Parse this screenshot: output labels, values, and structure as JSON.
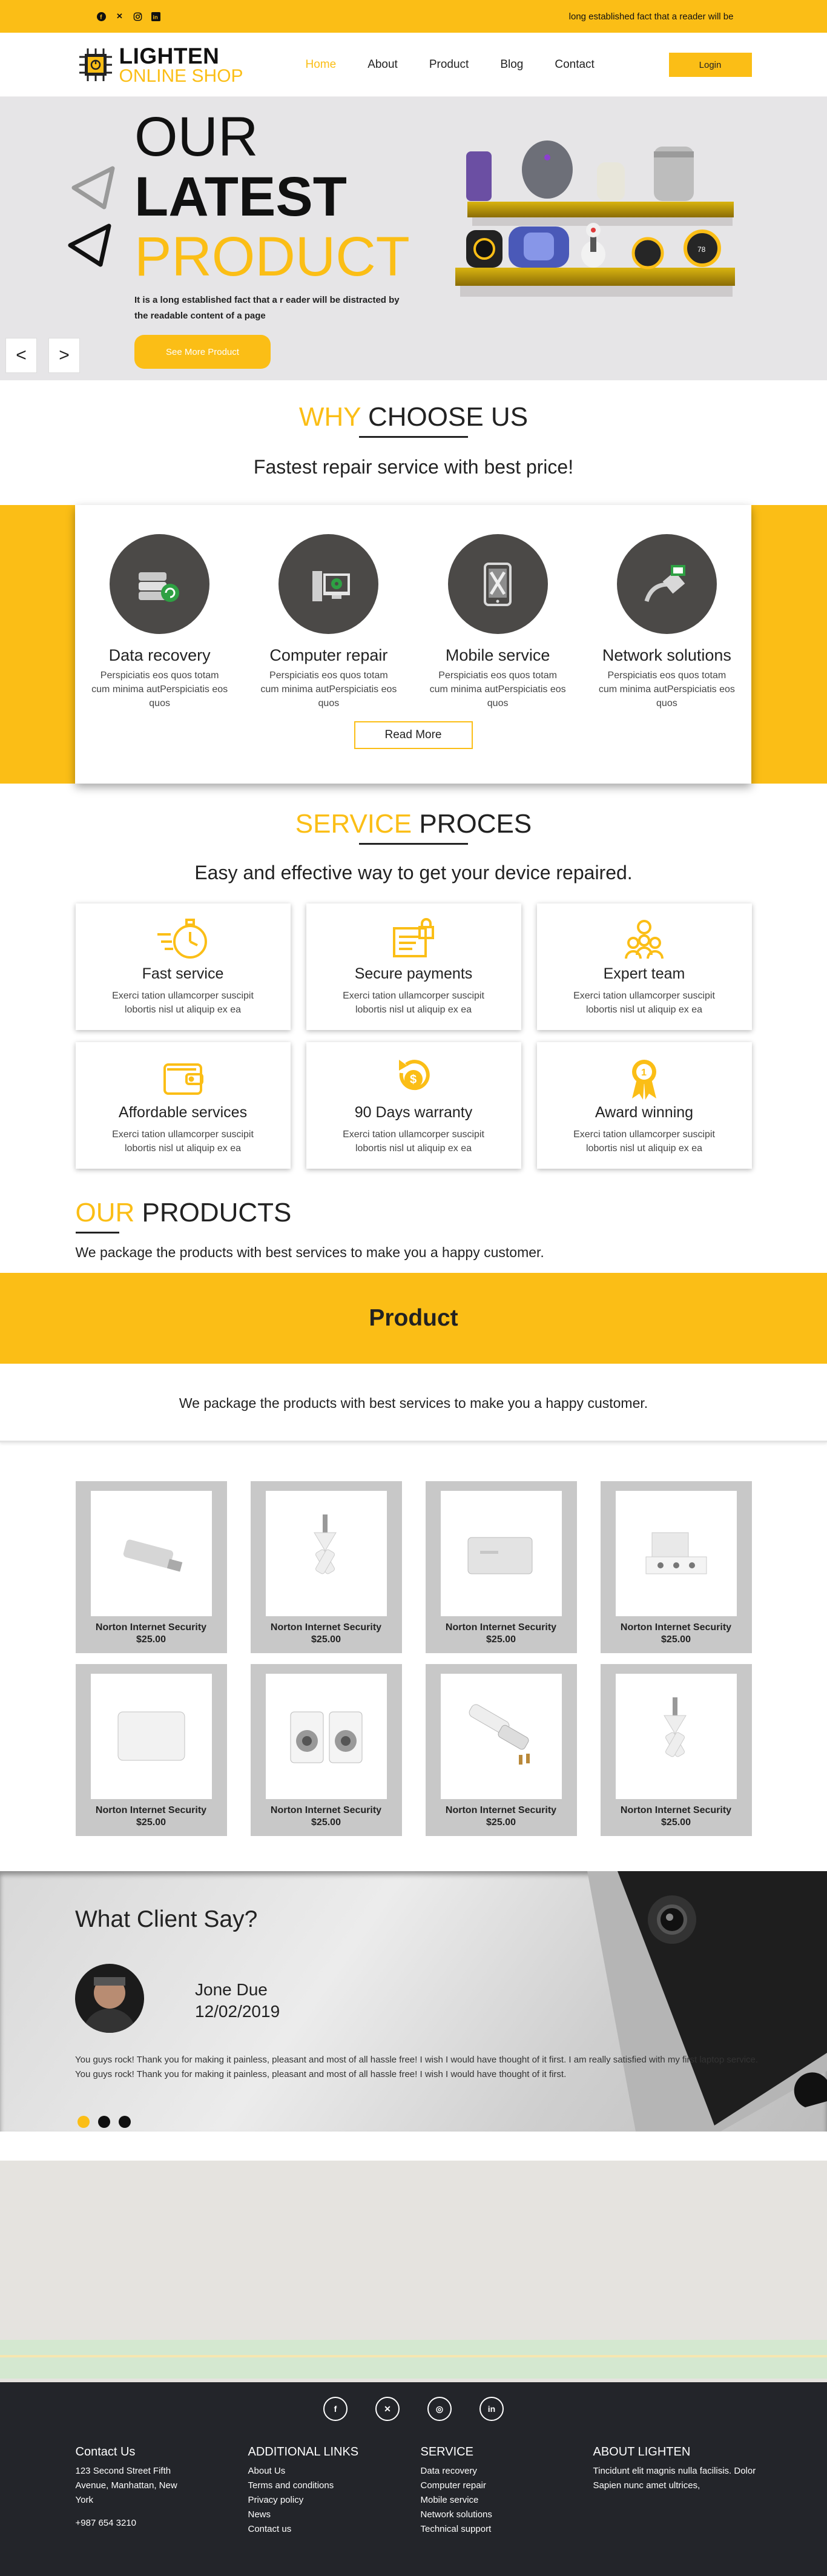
{
  "topbar": {
    "social_icons": [
      "facebook-icon",
      "x-icon",
      "instagram-icon",
      "linkedin-icon"
    ],
    "marquee": "long established fact that a reader will be"
  },
  "brand": {
    "line1": "LIGHTEN",
    "line2": "ONLINE SHOP",
    "accent": "#fbbe16",
    "dark": "#23252a"
  },
  "nav": {
    "items": [
      "Home",
      "About",
      "Product",
      "Blog",
      "Contact"
    ],
    "active": "Home",
    "login": "Login"
  },
  "hero": {
    "title1": "OUR",
    "title2": "LATEST",
    "title3": "PRODUCT",
    "desc": "It is a long established fact that a r eader will be distracted by the readable content of a page",
    "button": "See More Product",
    "prev": "<",
    "next": ">"
  },
  "why": {
    "title_accent": "WHY",
    "title_rest": " CHOOSE US",
    "subtitle": "Fastest repair service with best price!"
  },
  "services": {
    "items": [
      {
        "title": "Data recovery",
        "text": "Perspiciatis eos quos totam cum minima autPerspiciatis eos quos",
        "icon": "data-recovery-icon"
      },
      {
        "title": "Computer repair",
        "text": "Perspiciatis eos quos totam cum minima autPerspiciatis eos quos",
        "icon": "computer-repair-icon"
      },
      {
        "title": "Mobile service",
        "text": "Perspiciatis eos quos totam cum minima autPerspiciatis eos quos",
        "icon": "mobile-service-icon"
      },
      {
        "title": "Network solutions",
        "text": "Perspiciatis eos quos totam cum minima autPerspiciatis eos quos",
        "icon": "network-icon"
      }
    ],
    "read_more": "Read More"
  },
  "proces": {
    "title_accent": "SERVICE",
    "title_rest": " PROCES",
    "subtitle": "Easy and effective way to get your device repaired.",
    "items": [
      {
        "title": "Fast service",
        "text": "Exerci tation ullamcorper suscipit lobortis nisl ut aliquip ex ea",
        "icon": "stopwatch-icon"
      },
      {
        "title": "Secure payments",
        "text": "Exerci tation ullamcorper suscipit lobortis nisl ut aliquip ex ea",
        "icon": "secure-payment-icon"
      },
      {
        "title": "Expert team",
        "text": "Exerci tation ullamcorper suscipit lobortis nisl ut aliquip ex ea",
        "icon": "team-icon"
      },
      {
        "title": "Affordable services",
        "text": "Exerci tation ullamcorper suscipit lobortis nisl ut aliquip ex ea",
        "icon": "wallet-icon"
      },
      {
        "title": "90 Days warranty",
        "text": "Exerci tation ullamcorper suscipit lobortis nisl ut aliquip ex ea",
        "icon": "warranty-icon"
      },
      {
        "title": "Award winning",
        "text": "Exerci tation ullamcorper suscipit lobortis nisl ut aliquip ex ea",
        "icon": "award-icon"
      }
    ]
  },
  "products_section": {
    "title_accent": "OUR",
    "title_rest": " PRODUCTS",
    "subtitle": "We package the products with best services to make you a happy customer.",
    "band_title": "Product",
    "band_subtitle": "We package the products with best services to make you a happy customer.",
    "items": [
      {
        "name": "Norton Internet Security",
        "price": "$25.00",
        "icon": "usb-drive-icon"
      },
      {
        "name": "Norton Internet Security",
        "price": "$25.00",
        "icon": "audio-splitter-icon"
      },
      {
        "name": "Norton Internet Security",
        "price": "$25.00",
        "icon": "hard-drive-icon"
      },
      {
        "name": "Norton Internet Security",
        "price": "$25.00",
        "icon": "power-strip-icon"
      },
      {
        "name": "Norton Internet Security",
        "price": "$25.00",
        "icon": "external-drive-icon"
      },
      {
        "name": "Norton Internet Security",
        "price": "$25.00",
        "icon": "speakers-icon"
      },
      {
        "name": "Norton Internet Security",
        "price": "$25.00",
        "icon": "travel-adapter-icon"
      },
      {
        "name": "Norton Internet Security",
        "price": "$25.00",
        "icon": "audio-splitter-icon"
      }
    ]
  },
  "testimonial": {
    "title": "What Client Say?",
    "name": "Jone Due",
    "date": "12/02/2019",
    "quote1": "You guys rock! Thank you for making it painless, pleasant and most of all hassle free! I wish I would have thought of it first. I am really satisfied with my first laptop service.",
    "quote2": "You guys rock! Thank you for making it painless, pleasant and most of all hassle free! I wish I would have thought of it first.",
    "slides": 3,
    "active_slide": 1
  },
  "footer": {
    "social_icons": [
      "facebook-icon",
      "x-icon",
      "instagram-icon",
      "linkedin-icon"
    ],
    "contact": {
      "title": "Contact Us",
      "address": "123 Second Street Fifth Avenue, Manhattan, New York",
      "phone": "+987 654 3210"
    },
    "links": {
      "title": "ADDITIONAL LINKS",
      "items": [
        "About Us",
        "Terms and conditions",
        "Privacy policy",
        "News",
        "Contact us"
      ]
    },
    "service": {
      "title": "SERVICE",
      "items": [
        "Data recovery",
        "Computer repair",
        "Mobile service",
        "Network solutions",
        "Technical support"
      ]
    },
    "about": {
      "title": "ABOUT LIGHTEN",
      "text": "Tincidunt elit magnis nulla facilisis. Dolor Sapien nunc amet ultrices,"
    }
  }
}
